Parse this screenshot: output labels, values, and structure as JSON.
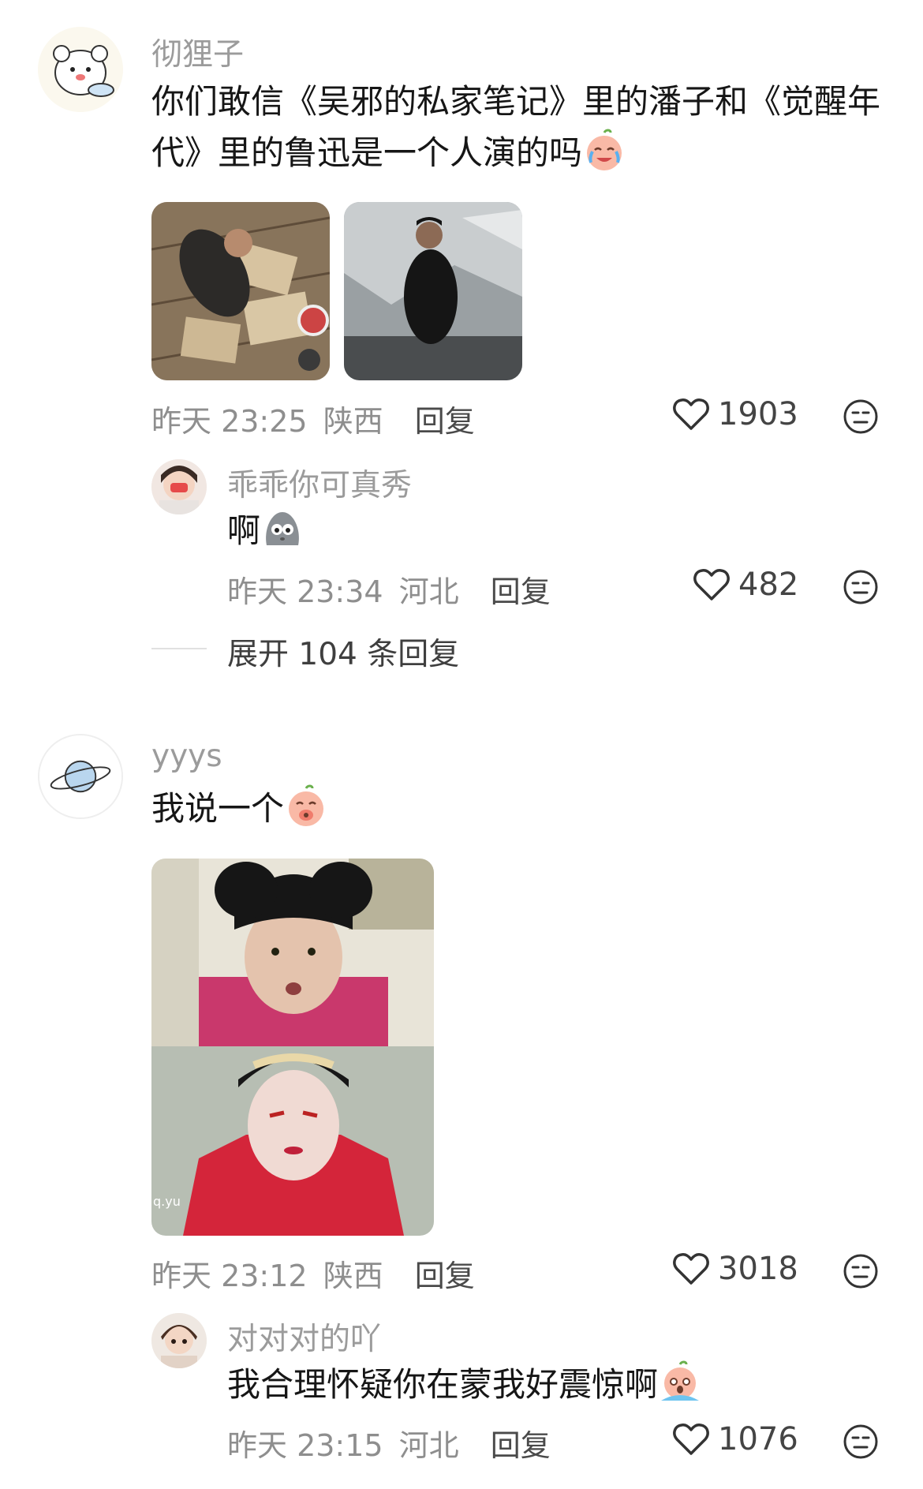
{
  "comments": [
    {
      "username": "彻狸子",
      "text_line1": "你们敢信《吴邪的私家笔记》里的潘子和《觉醒年",
      "text_line2": "代》里的鲁迅是一个人演的吗",
      "emoji": "crying-laugh-peach-emoji",
      "images": [
        "scene-lying-on-floor-photo",
        "man-in-black-coat-photo"
      ],
      "time": "昨天 23:25",
      "location": "陕西",
      "reply_label": "回复",
      "likes": "1903",
      "reply": {
        "username": "乖乖你可真秀",
        "text": "啊",
        "emoji": "grey-blob-emoji",
        "time": "昨天 23:34",
        "location": "河北",
        "reply_label": "回复",
        "likes": "482"
      },
      "expand_label": "展开 104 条回复"
    },
    {
      "username": "yyys",
      "text": "我说一个",
      "emoji": "covering-mouth-peach-emoji",
      "images": [
        "actress-comparison-photo"
      ],
      "watermark": "q.yu",
      "time": "昨天 23:12",
      "location": "陕西",
      "reply_label": "回复",
      "likes": "3018",
      "reply": {
        "username": "对对对的吖",
        "text": "我合理怀疑你在蒙我好震惊啊",
        "emoji": "shocked-crying-peach-emoji",
        "time": "昨天 23:15",
        "location": "河北",
        "reply_label": "回复",
        "likes": "1076"
      }
    }
  ],
  "colors": {
    "username": "#9b9b9b",
    "text": "#161616",
    "meta": "#8e8e8e",
    "peach": "#f9b9a6"
  }
}
